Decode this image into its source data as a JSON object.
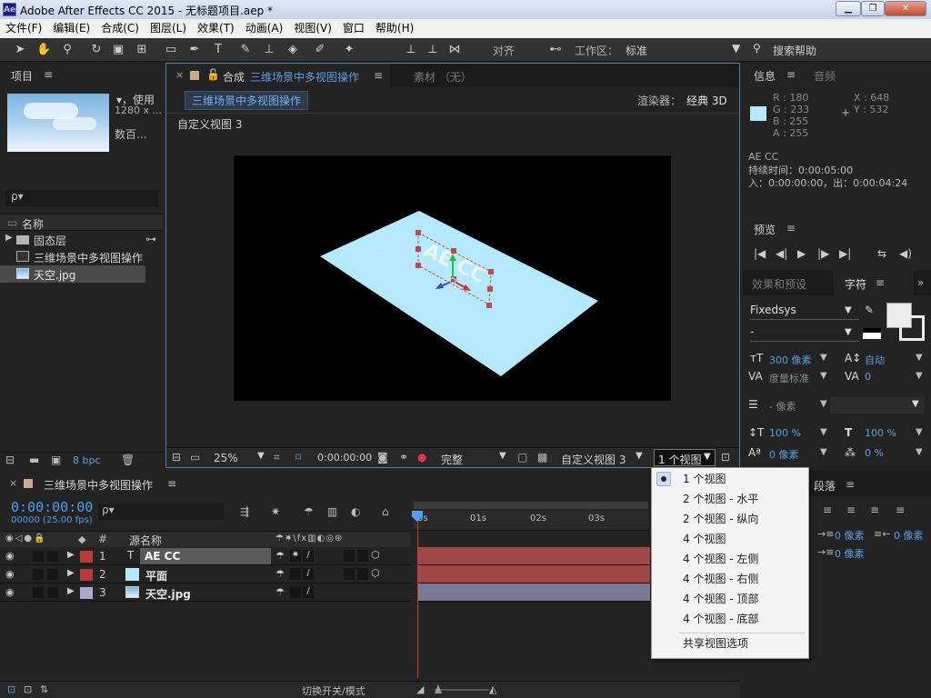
{
  "app": {
    "title": "Adobe After Effects CC 2015 - 无标题项目.aep *",
    "icon_label": "Ae"
  },
  "window_controls": {
    "minimize": "▁",
    "restore": "❐",
    "close": "✕"
  },
  "menu": [
    "文件(F)",
    "编辑(E)",
    "合成(C)",
    "图层(L)",
    "效果(T)",
    "动画(A)",
    "视图(V)",
    "窗口",
    "帮助(H)"
  ],
  "toolbar": {
    "snap_label": "对齐",
    "workspace_label": "工作区：",
    "workspace_value": "标准",
    "search_help": "搜索帮助"
  },
  "project": {
    "tab": "项目",
    "asset_info": [
      "▾，使用",
      "1280 x ...",
      "数百..."
    ],
    "search_placeholder": "ρ▾",
    "col_name": "名称",
    "items": [
      {
        "name": "固态层",
        "type": "folder"
      },
      {
        "name": "三维场景中多视图操作",
        "type": "comp"
      },
      {
        "name": "天空.jpg",
        "type": "image"
      }
    ],
    "bpc": "8 bpc"
  },
  "comp": {
    "tab_prefix": "合成",
    "tab_name": "三维场景中多视图操作",
    "footage_tab": "素材 （无）",
    "breadcrumb": "三维场景中多视图操作",
    "renderer_label": "渲染器：",
    "renderer_value": "经典 3D",
    "view_label": "自定义视图 3",
    "layer_text": "AE CC"
  },
  "viewer_bar": {
    "zoom": "25%",
    "timecode": "0:00:00:00",
    "resolution": "完整",
    "view": "自定义视图 3",
    "layout": "1 个视图"
  },
  "dropdown": {
    "items": [
      "1 个视图",
      "2 个视图 - 水平",
      "2 个视图 - 纵向",
      "4 个视图",
      "4 个视图 - 左侧",
      "4 个视图 - 右侧",
      "4 个视图 - 顶部",
      "4 个视图 - 底部"
    ],
    "footer": "共享视图选项",
    "selected_index": 0
  },
  "info": {
    "tab": "信息",
    "tab2": "音频",
    "r": "R : 180",
    "g": "G : 233",
    "b": "B : 255",
    "a": "A : 255",
    "x": "X : 648",
    "y": "Y : 532",
    "layer_name": "AE CC",
    "duration": "持续时间：0:00:05:00",
    "inout": "入：0:00:00:00，出：0:00:04:24",
    "swatch_color": "#b4e9ff"
  },
  "preview": {
    "tab": "预览"
  },
  "effects": {
    "tab": "效果和预设",
    "tab2": "字符"
  },
  "character": {
    "font": "Fixedsys",
    "style": "-",
    "size": "300 像素",
    "leading": "自动",
    "kerning": "度量标准",
    "tracking": "0",
    "stroke": "- 像素",
    "vscale": "100 %",
    "hscale": "100 %",
    "baseline": "0 像素",
    "tsume": "0 %"
  },
  "paragraph": {
    "tab": "段落",
    "indent1": "0 像素",
    "indent2": "0 像素",
    "indent3": "0 像素"
  },
  "timeline": {
    "tab": "三维场景中多视图操作",
    "timecode": "0:00:00:00",
    "frames": "00000 (25.00 fps)",
    "col_hash": "#",
    "col_source": "源名称",
    "ruler": [
      "0s",
      "01s",
      "02s",
      "03s"
    ],
    "layers": [
      {
        "num": "1",
        "name": "AE CC",
        "label_color": "#b83a3a",
        "bar_color": "#a04646"
      },
      {
        "num": "2",
        "name": "平面",
        "label_color": "#b83a3a",
        "bar_color": "#a04646"
      },
      {
        "num": "3",
        "name": "天空.jpg",
        "label_color": "#a9a9d0",
        "bar_color": "#7a7a94"
      }
    ],
    "switch_mode": "切换开关/模式"
  }
}
